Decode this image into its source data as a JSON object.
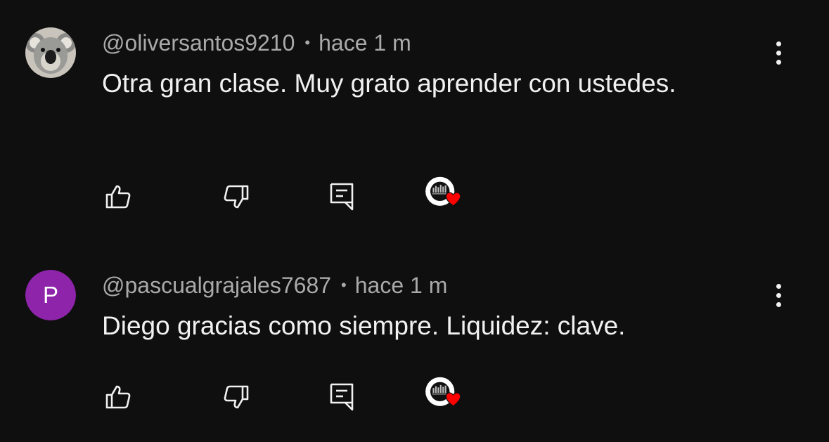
{
  "colors": {
    "background": "#0f0f0f",
    "text_primary": "#f1f1f1",
    "text_secondary": "#aaaaaa",
    "avatar_letter_bg": "#8e24aa",
    "heart": "#ff0000"
  },
  "comments": [
    {
      "author": "@oliversantos9210",
      "separator": "•",
      "time": "hace 1 m",
      "text": "Otra gran clase. Muy grato aprender con ustedes.",
      "avatar": {
        "type": "image",
        "icon": "koala-avatar"
      }
    },
    {
      "author": "@pascualgrajales7687",
      "separator": "•",
      "time": "hace 1 m",
      "text": "Diego gracias como siempre. Liquidez: clave.",
      "avatar": {
        "type": "letter",
        "letter": "P"
      }
    }
  ],
  "icons": {
    "like": "thumbs-up-icon",
    "dislike": "thumbs-down-icon",
    "reply": "reply-comment-icon",
    "creator_heart": "creator-heart-icon",
    "more": "more-vertical-icon"
  }
}
